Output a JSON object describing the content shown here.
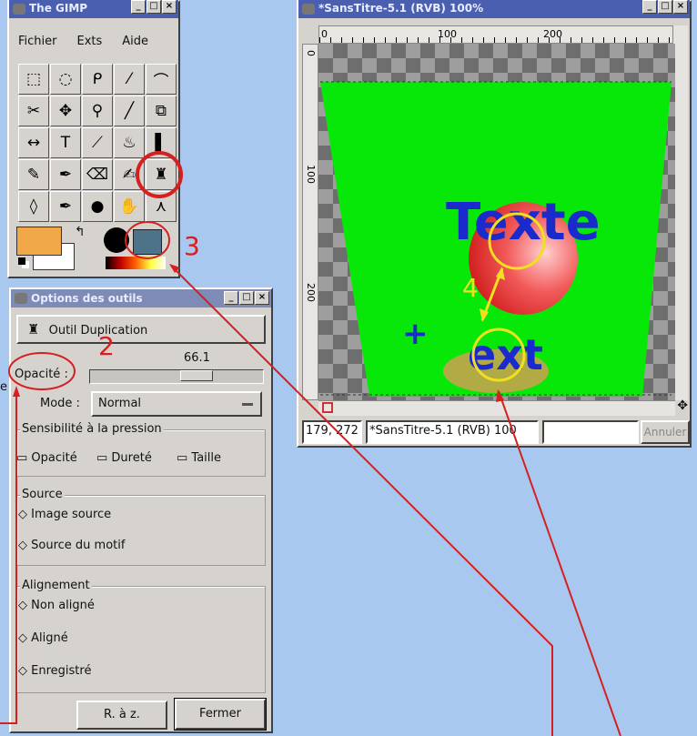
{
  "toolbox": {
    "title": "The GIMP",
    "menu": [
      "Fichier",
      "Exts",
      "Aide"
    ],
    "tools": [
      "rect-select-icon",
      "ellipse-select-icon",
      "lasso-icon",
      "magic-wand-icon",
      "bezier-path-icon",
      "scissors-icon",
      "move-icon",
      "magnify-icon",
      "crop-icon",
      "transform-icon",
      "flip-icon",
      "text-icon",
      "color-picker-icon",
      "bucket-fill-icon",
      "gradient-icon",
      "pencil-icon",
      "brush-icon",
      "eraser-icon",
      "airbrush-icon",
      "clone-icon",
      "blur-icon",
      "ink-icon",
      "dodge-burn-icon",
      "smudge-icon",
      "measure-icon"
    ],
    "glyphs": [
      "⬚",
      "◌",
      "ᑭ",
      "⁄",
      "⌒",
      "✂",
      "✥",
      "⚲",
      "╱",
      "⧉",
      "↔",
      "T",
      "⟋",
      "♨",
      "▌",
      "✎",
      "✒",
      "⌫",
      "✍",
      "♜",
      "◊",
      "✒",
      "●",
      "✋",
      "⋏"
    ],
    "fg_color": "#f0a848",
    "bg_color": "#ffffff"
  },
  "options": {
    "title": "Options des outils",
    "tool_name": "Outil Duplication",
    "opacity_label": "Opacité :",
    "opacity_value": "66.1",
    "opacity_fraction": 0.661,
    "mode_label": "Mode :",
    "mode_value": "Normal",
    "pressure_title": "Sensibilité à la pression",
    "pressure_opts": [
      "Opacité",
      "Dureté",
      "Taille"
    ],
    "source_title": "Source",
    "source_opts": [
      "Image source",
      "Source du motif"
    ],
    "align_title": "Alignement",
    "align_opts": [
      "Non aligné",
      "Aligné",
      "Enregistré"
    ],
    "reset_label": "R. à z.",
    "close_label": "Fermer"
  },
  "image_window": {
    "title": "*SansTitre-5.1 (RVB) 100%",
    "ruler_marks": [
      "0",
      "100",
      "200"
    ],
    "vruler_marks": [
      "0",
      "100",
      "200"
    ],
    "coords": "179, 272",
    "status": "*SansTitre-5.1 (RVB) 100",
    "cancel_label": "Annuler",
    "text_upper": "Texte",
    "text_lower": "ext"
  },
  "annotations": {
    "n2": "2",
    "n3": "3",
    "n4": "4",
    "side_letter": "e"
  }
}
